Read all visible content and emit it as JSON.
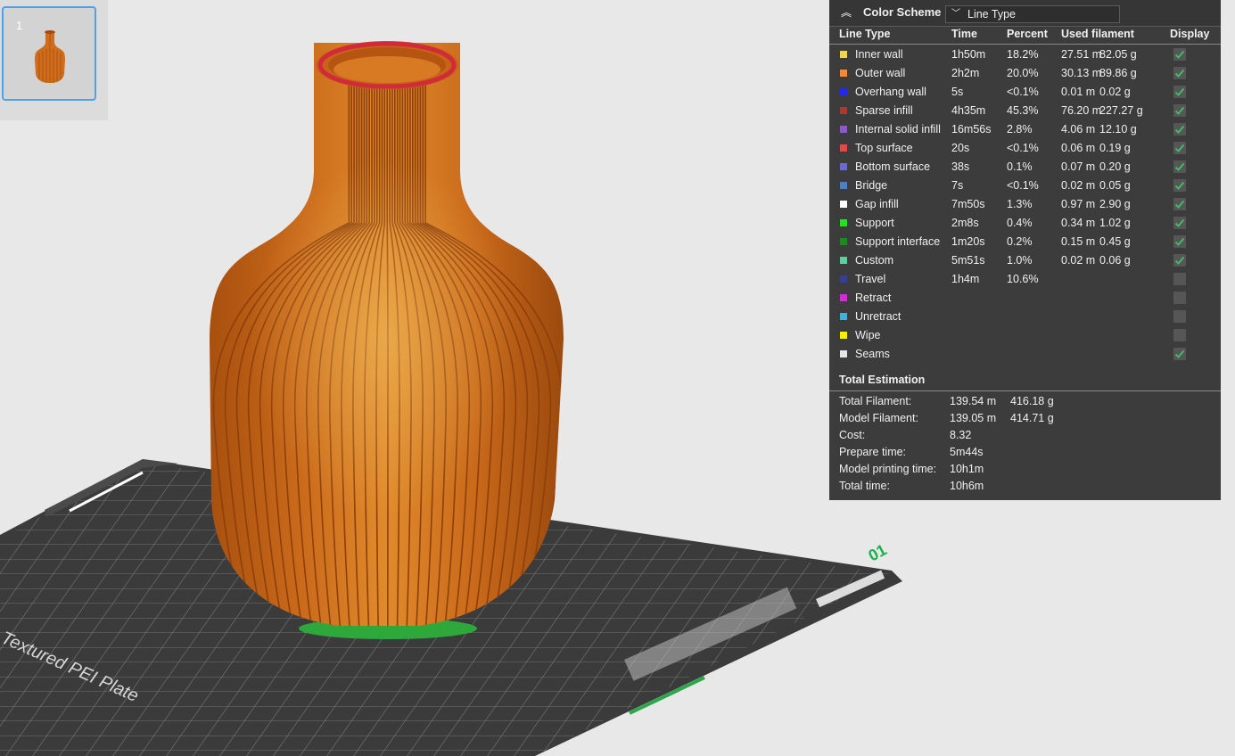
{
  "plate_thumbnail": {
    "number": "1"
  },
  "legend": {
    "header": {
      "title": "Color Scheme",
      "scheme_value": "Line Type"
    },
    "columns": {
      "line_type": "Line Type",
      "time": "Time",
      "percent": "Percent",
      "used_filament": "Used filament",
      "display": "Display"
    },
    "rows": [
      {
        "name": "Inner wall",
        "color": "#f5d442",
        "time": "1h50m",
        "percent": "18.2%",
        "length": "27.51 m",
        "weight": "82.05 g",
        "displayed": true
      },
      {
        "name": "Outer wall",
        "color": "#f08a3c",
        "time": "2h2m",
        "percent": "20.0%",
        "length": "30.13 m",
        "weight": "89.86 g",
        "displayed": true
      },
      {
        "name": "Overhang wall",
        "color": "#1f2be8",
        "time": "5s",
        "percent": "<0.1%",
        "length": "0.01 m",
        "weight": "0.02 g",
        "displayed": true
      },
      {
        "name": "Sparse infill",
        "color": "#a83a30",
        "time": "4h35m",
        "percent": "45.3%",
        "length": "76.20 m",
        "weight": "227.27 g",
        "displayed": true
      },
      {
        "name": "Internal solid infill",
        "color": "#8e58c8",
        "time": "16m56s",
        "percent": "2.8%",
        "length": "4.06 m",
        "weight": "12.10 g",
        "displayed": true
      },
      {
        "name": "Top surface",
        "color": "#e84545",
        "time": "20s",
        "percent": "<0.1%",
        "length": "0.06 m",
        "weight": "0.19 g",
        "displayed": true
      },
      {
        "name": "Bottom surface",
        "color": "#6a6ad0",
        "time": "38s",
        "percent": "0.1%",
        "length": "0.07 m",
        "weight": "0.20 g",
        "displayed": true
      },
      {
        "name": "Bridge",
        "color": "#4a80c4",
        "time": "7s",
        "percent": "<0.1%",
        "length": "0.02 m",
        "weight": "0.05 g",
        "displayed": true
      },
      {
        "name": "Gap infill",
        "color": "#ffffff",
        "time": "7m50s",
        "percent": "1.3%",
        "length": "0.97 m",
        "weight": "2.90 g",
        "displayed": true
      },
      {
        "name": "Support",
        "color": "#22e022",
        "time": "2m8s",
        "percent": "0.4%",
        "length": "0.34 m",
        "weight": "1.02 g",
        "displayed": true
      },
      {
        "name": "Support interface",
        "color": "#1e8a1e",
        "time": "1m20s",
        "percent": "0.2%",
        "length": "0.15 m",
        "weight": "0.45 g",
        "displayed": true
      },
      {
        "name": "Custom",
        "color": "#5ecf9a",
        "time": "5m51s",
        "percent": "1.0%",
        "length": "0.02 m",
        "weight": "0.06 g",
        "displayed": true
      },
      {
        "name": "Travel",
        "color": "#34408f",
        "time": "1h4m",
        "percent": "10.6%",
        "length": "",
        "weight": "",
        "displayed": false
      },
      {
        "name": "Retract",
        "color": "#d02fd0",
        "time": "",
        "percent": "",
        "length": "",
        "weight": "",
        "displayed": false
      },
      {
        "name": "Unretract",
        "color": "#43b0d8",
        "time": "",
        "percent": "",
        "length": "",
        "weight": "",
        "displayed": false
      },
      {
        "name": "Wipe",
        "color": "#ffee00",
        "time": "",
        "percent": "",
        "length": "",
        "weight": "",
        "displayed": false
      },
      {
        "name": "Seams",
        "color": "#e6e6e6",
        "time": "",
        "percent": "",
        "length": "",
        "weight": "",
        "displayed": true
      }
    ],
    "totals": {
      "title": "Total Estimation",
      "items": [
        {
          "label": "Total Filament:",
          "v1": "139.54 m",
          "v2": "416.18 g"
        },
        {
          "label": "Model Filament:",
          "v1": "139.05 m",
          "v2": "414.71 g"
        },
        {
          "label": "Cost:",
          "v1": "8.32",
          "v2": ""
        },
        {
          "label": "Prepare time:",
          "v1": "5m44s",
          "v2": ""
        },
        {
          "label": "Model printing time:",
          "v1": "10h1m",
          "v2": ""
        },
        {
          "label": "Total time:",
          "v1": "10h6m",
          "v2": ""
        }
      ]
    }
  },
  "scene": {
    "plate_label": "Textured PEI Plate",
    "plate_number": "01"
  },
  "colors": {
    "panel_bg": "#3c3c3c",
    "check_green": "#3fc16a",
    "model_orange": "#c86418",
    "thumb_border": "#4ea1e6"
  }
}
